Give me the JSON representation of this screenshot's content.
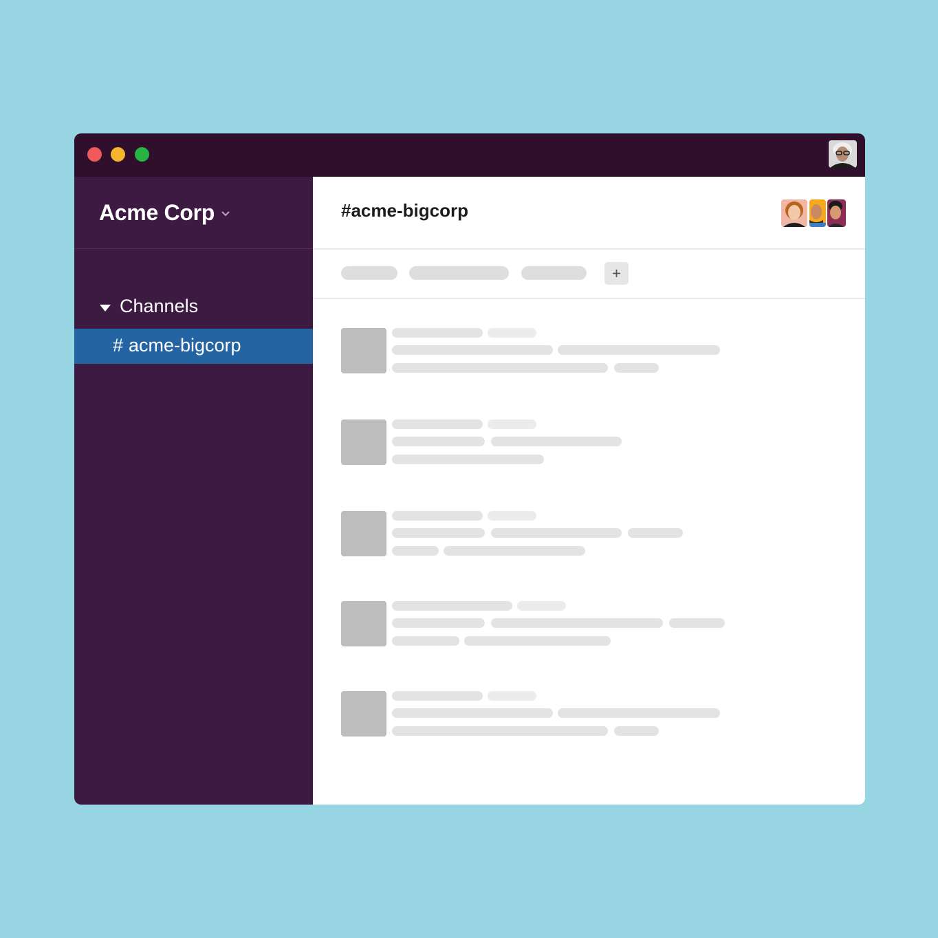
{
  "workspace": {
    "name": "Acme Corp"
  },
  "sidebar": {
    "section_label": "Channels",
    "channels": [
      {
        "hash": "#",
        "name": "acme-bigcorp",
        "selected": true
      }
    ]
  },
  "channel": {
    "title": "#acme-bigcorp"
  },
  "colors": {
    "background": "#98d6e3",
    "titlebar": "#2f0f2b",
    "sidebar": "#3c1a41",
    "selected_channel": "#2464a3",
    "skeleton": "#dedede",
    "skeleton_avatar": "#bdbdbd"
  },
  "icons": {
    "traffic_lights": [
      "close-dot",
      "minimize-dot",
      "maximize-dot"
    ],
    "workspace_menu": "chevron-down-icon",
    "section_toggle": "caret-down-icon",
    "add_tab": "plus-icon"
  }
}
